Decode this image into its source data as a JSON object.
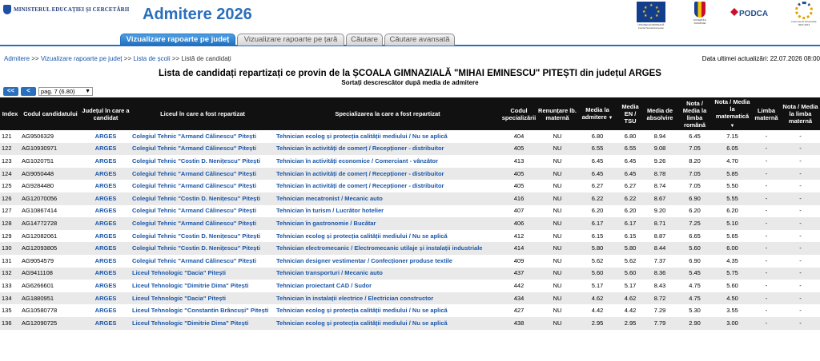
{
  "header": {
    "ministry": "MINISTERUL EDUCAȚIEI ȘI CERCETĂRII",
    "app_title": "Admitere 2026",
    "logos": {
      "eu_caption": "UNIUNEA EUROPEANĂ Fondul Social European",
      "gov_caption": "GUVERNUL ROMÂNIEI",
      "podca": "PODCA",
      "is_caption": "Instrumente Structurale 2007-2013"
    }
  },
  "tabs": [
    {
      "label": "Vizualizare rapoarte pe județ",
      "active": true
    },
    {
      "label": "Vizualizare rapoarte pe țară",
      "active": false
    },
    {
      "label": "Căutare",
      "active": false
    },
    {
      "label": "Căutare avansată",
      "active": false
    }
  ],
  "breadcrumb": {
    "items": [
      "Admitere",
      "Vizualizare rapoarte pe județ",
      "Lista de școli"
    ],
    "current": "Listă de candidați",
    "separator": ">>"
  },
  "last_update": "Data ultimei actualizări: 22.07.2026 08:00",
  "title": "Lista de candidați repartizați ce provin de la ȘCOALA GIMNAZIALĂ \"MIHAI EMINESCU\" PITEȘTI din județul ARGES",
  "subtitle": "Sortați descrescător după media de admitere",
  "pager": {
    "first": "<<",
    "prev": "<",
    "selected": "pag. 7 (6.80)"
  },
  "columns": [
    "Index",
    "Codul candidatului",
    "Județul în care a candidat",
    "Liceul în care a fost repartizat",
    "Specializarea la care a fost repartizat",
    "Codul specializării",
    "Renunțare lb. maternă",
    "Media la admitere",
    "Media EN / TSU",
    "Media de absolvire",
    "Nota / Media la limba română",
    "Nota / Media la matematică",
    "Limba maternă",
    "Nota / Media la limba maternă"
  ],
  "rows": [
    [
      "121",
      "AG9506329",
      "ARGES",
      "Colegiul Tehnic \"Armand Călinescu\" Pitești",
      "Tehnician ecolog și protecția calității mediului / Nu se aplică",
      "404",
      "NU",
      "6.80",
      "6.80",
      "8.94",
      "6.45",
      "7.15",
      "-",
      "-"
    ],
    [
      "122",
      "AG10930971",
      "ARGES",
      "Colegiul Tehnic \"Armand Călinescu\" Pitești",
      "Tehnician în activități de comerț / Recepționer - distribuitor",
      "405",
      "NU",
      "6.55",
      "6.55",
      "9.08",
      "7.05",
      "6.05",
      "-",
      "-"
    ],
    [
      "123",
      "AG1020751",
      "ARGES",
      "Colegiul Tehnic \"Costin D. Nenițescu\" Pitești",
      "Tehnician în activități economice / Comerciant - vânzător",
      "413",
      "NU",
      "6.45",
      "6.45",
      "9.26",
      "8.20",
      "4.70",
      "-",
      "-"
    ],
    [
      "124",
      "AG9050448",
      "ARGES",
      "Colegiul Tehnic \"Armand Călinescu\" Pitești",
      "Tehnician în activități de comerț / Recepționer - distribuitor",
      "405",
      "NU",
      "6.45",
      "6.45",
      "8.78",
      "7.05",
      "5.85",
      "-",
      "-"
    ],
    [
      "125",
      "AG9284480",
      "ARGES",
      "Colegiul Tehnic \"Armand Călinescu\" Pitești",
      "Tehnician în activități de comerț / Recepționer - distribuitor",
      "405",
      "NU",
      "6.27",
      "6.27",
      "8.74",
      "7.05",
      "5.50",
      "-",
      "-"
    ],
    [
      "126",
      "AG12070056",
      "ARGES",
      "Colegiul Tehnic \"Costin D. Nenițescu\" Pitești",
      "Tehnician mecatronist / Mecanic auto",
      "416",
      "NU",
      "6.22",
      "6.22",
      "8.67",
      "6.90",
      "5.55",
      "-",
      "-"
    ],
    [
      "127",
      "AG10867414",
      "ARGES",
      "Colegiul Tehnic \"Armand Călinescu\" Pitești",
      "Tehnician în turism / Lucrător hotelier",
      "407",
      "NU",
      "6.20",
      "6.20",
      "9.20",
      "6.20",
      "6.20",
      "-",
      "-"
    ],
    [
      "128",
      "AG14772728",
      "ARGES",
      "Colegiul Tehnic \"Armand Călinescu\" Pitești",
      "Tehnician în gastronomie / Bucătar",
      "406",
      "NU",
      "6.17",
      "6.17",
      "8.71",
      "7.25",
      "5.10",
      "-",
      "-"
    ],
    [
      "129",
      "AG12082061",
      "ARGES",
      "Colegiul Tehnic \"Costin D. Nenițescu\" Pitești",
      "Tehnician ecolog și protecția calității mediului / Nu se aplică",
      "412",
      "NU",
      "6.15",
      "6.15",
      "8.87",
      "6.65",
      "5.65",
      "-",
      "-"
    ],
    [
      "130",
      "AG12093805",
      "ARGES",
      "Colegiul Tehnic \"Costin D. Nenițescu\" Pitești",
      "Tehnician electromecanic / Electromecanic utilaje și instalații industriale",
      "414",
      "NU",
      "5.80",
      "5.80",
      "8.44",
      "5.60",
      "6.00",
      "-",
      "-"
    ],
    [
      "131",
      "AG9054579",
      "ARGES",
      "Colegiul Tehnic \"Armand Călinescu\" Pitești",
      "Tehnician designer vestimentar / Confecționer produse textile",
      "409",
      "NU",
      "5.62",
      "5.62",
      "7.37",
      "6.90",
      "4.35",
      "-",
      "-"
    ],
    [
      "132",
      "AG9411108",
      "ARGES",
      "Liceul Tehnologic \"Dacia\" Pitești",
      "Tehnician transporturi / Mecanic auto",
      "437",
      "NU",
      "5.60",
      "5.60",
      "8.36",
      "5.45",
      "5.75",
      "-",
      "-"
    ],
    [
      "133",
      "AG6266601",
      "ARGES",
      "Liceul Tehnologic \"Dimitrie Dima\" Pitești",
      "Tehnician proiectant CAD / Sudor",
      "442",
      "NU",
      "5.17",
      "5.17",
      "8.43",
      "4.75",
      "5.60",
      "-",
      "-"
    ],
    [
      "134",
      "AG1880951",
      "ARGES",
      "Liceul Tehnologic \"Dacia\" Pitești",
      "Tehnician în instalații electrice / Electrician constructor",
      "434",
      "NU",
      "4.62",
      "4.62",
      "8.72",
      "4.75",
      "4.50",
      "-",
      "-"
    ],
    [
      "135",
      "AG10580778",
      "ARGES",
      "Liceul Tehnologic \"Constantin Brâncuși\" Pitești",
      "Tehnician ecolog și protecția calității mediului / Nu se aplică",
      "427",
      "NU",
      "4.42",
      "4.42",
      "7.29",
      "5.30",
      "3.55",
      "-",
      "-"
    ],
    [
      "136",
      "AG12090725",
      "ARGES",
      "Liceul Tehnologic \"Dimitrie Dima\" Pitești",
      "Tehnician ecolog și protecția calității mediului / Nu se aplică",
      "438",
      "NU",
      "2.95",
      "2.95",
      "7.79",
      "2.90",
      "3.00",
      "-",
      "-"
    ]
  ],
  "colors": {
    "accent": "#2a6fbd",
    "link": "#1a56a8",
    "header_bg": "#111111"
  }
}
